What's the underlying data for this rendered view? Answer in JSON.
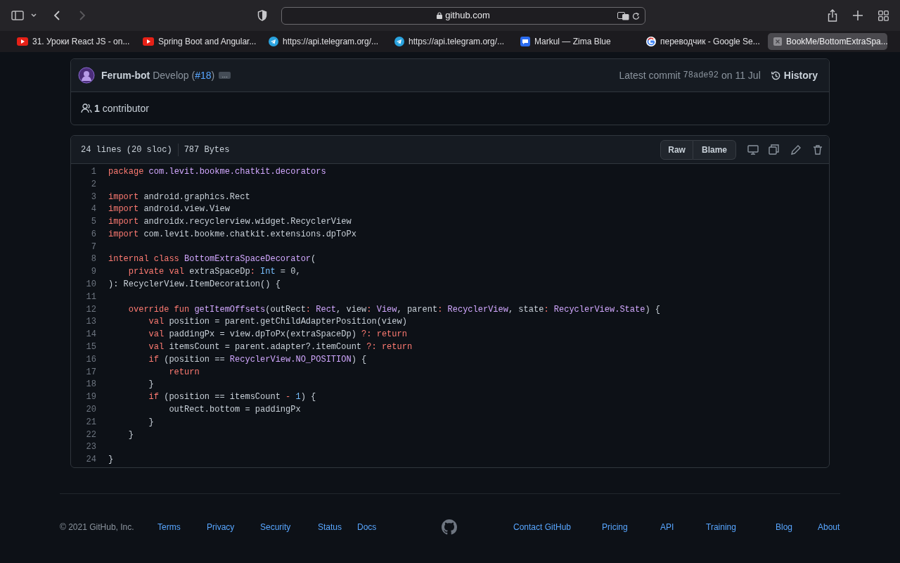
{
  "browser": {
    "address": "github.com",
    "tabs": [
      {
        "label": "31. Уроки React JS - on...",
        "kind": "video",
        "selected": false
      },
      {
        "label": "Spring Boot and Angular...",
        "kind": "video",
        "selected": false
      },
      {
        "label": "https://api.telegram.org/...",
        "kind": "telegram",
        "selected": false
      },
      {
        "label": "https://api.telegram.org/...",
        "kind": "telegram",
        "selected": false
      },
      {
        "label": "Markul — Zima Blue",
        "kind": "chat",
        "selected": false
      },
      {
        "label": "переводчик - Google Se...",
        "kind": "google",
        "selected": false
      },
      {
        "label": "BookMe/BottomExtraSpa...",
        "kind": "close",
        "selected": true
      }
    ]
  },
  "commit": {
    "author": "Ferum-bot",
    "message": "Develop (",
    "pr": "#18",
    "message_end": ")",
    "ellipsis": "…",
    "latest_label": "Latest commit",
    "sha": "78ade92",
    "date": "on 11 Jul",
    "history": "History",
    "contributors": "1",
    "contributors_label": "contributor"
  },
  "file": {
    "lines_info": "24 lines (20 sloc)",
    "size": "787 Bytes",
    "buttons": [
      "Raw",
      "Blame"
    ],
    "lines": [
      {
        "number": "1",
        "tokens": [
          {
            "kind": "keyword",
            "text": "package"
          },
          {
            "kind": "entity",
            "text": " com.levit.bookme.chatkit.decorators"
          }
        ]
      },
      {
        "number": "2"
      },
      {
        "number": "3",
        "tokens": [
          {
            "kind": "keyword",
            "text": "import"
          },
          {
            "kind": "plain",
            "text": " android.graphics.Rect"
          }
        ]
      },
      {
        "number": "4",
        "tokens": [
          {
            "kind": "keyword",
            "text": "import"
          },
          {
            "kind": "plain",
            "text": " android.view.View"
          }
        ]
      },
      {
        "number": "5",
        "tokens": [
          {
            "kind": "keyword",
            "text": "import"
          },
          {
            "kind": "plain",
            "text": " androidx.recyclerview.widget.RecyclerView"
          }
        ]
      },
      {
        "number": "6",
        "tokens": [
          {
            "kind": "keyword",
            "text": "import"
          },
          {
            "kind": "plain",
            "text": " com.levit.bookme.chatkit.extensions.dpToPx"
          }
        ]
      },
      {
        "number": "7"
      },
      {
        "number": "8",
        "tokens": [
          {
            "kind": "keyword",
            "text": "internal class"
          },
          {
            "kind": "entity",
            "text": " BottomExtraSpaceDecorator"
          },
          {
            "kind": "plain",
            "text": "("
          }
        ]
      },
      {
        "number": "9",
        "tokens": [
          {
            "kind": "keyword",
            "text": "    private val"
          },
          {
            "kind": "plain",
            "text": " extraSpaceDp"
          },
          {
            "kind": "keyword",
            "text": ":"
          },
          {
            "kind": "constant",
            "text": " Int"
          },
          {
            "kind": "plain",
            "text": " = 0,"
          }
        ]
      },
      {
        "number": "10",
        "tokens": [
          {
            "kind": "plain",
            "text": "): RecyclerView.ItemDecoration() {"
          }
        ]
      },
      {
        "number": "11"
      },
      {
        "number": "12",
        "tokens": [
          {
            "kind": "keyword",
            "text": "    override fun"
          },
          {
            "kind": "entity",
            "text": " getItemOffsets"
          },
          {
            "kind": "plain",
            "text": "(outRect"
          },
          {
            "kind": "keyword",
            "text": ":"
          },
          {
            "kind": "entity",
            "text": " Rect"
          },
          {
            "kind": "plain",
            "text": ", view"
          },
          {
            "kind": "keyword",
            "text": ":"
          },
          {
            "kind": "entity",
            "text": " View"
          },
          {
            "kind": "plain",
            "text": ", parent"
          },
          {
            "kind": "keyword",
            "text": ":"
          },
          {
            "kind": "entity",
            "text": " RecyclerView"
          },
          {
            "kind": "plain",
            "text": ", state"
          },
          {
            "kind": "keyword",
            "text": ":"
          },
          {
            "kind": "entity",
            "text": " RecyclerView.State"
          },
          {
            "kind": "plain",
            "text": ") {"
          }
        ]
      },
      {
        "number": "13",
        "tokens": [
          {
            "kind": "keyword",
            "text": "        val"
          },
          {
            "kind": "plain",
            "text": " position = parent.getChildAdapterPosition(view)"
          }
        ]
      },
      {
        "number": "14",
        "tokens": [
          {
            "kind": "keyword",
            "text": "        val"
          },
          {
            "kind": "plain",
            "text": " paddingPx = view.dpToPx(extraSpaceDp)"
          },
          {
            "kind": "keyword",
            "text": " ?: return"
          }
        ]
      },
      {
        "number": "15",
        "tokens": [
          {
            "kind": "keyword",
            "text": "        val"
          },
          {
            "kind": "plain",
            "text": " itemsCount = parent.adapter?.itemCount"
          },
          {
            "kind": "keyword",
            "text": " ?: return"
          }
        ]
      },
      {
        "number": "16",
        "tokens": [
          {
            "kind": "keyword",
            "text": "        if"
          },
          {
            "kind": "plain",
            "text": " (position =="
          },
          {
            "kind": "entity",
            "text": " RecyclerView.NO_POSITION"
          },
          {
            "kind": "plain",
            "text": ") {"
          }
        ]
      },
      {
        "number": "17",
        "tokens": [
          {
            "kind": "keyword",
            "text": "            return"
          }
        ]
      },
      {
        "number": "18",
        "tokens": [
          {
            "kind": "plain",
            "text": "        }"
          }
        ]
      },
      {
        "number": "19",
        "tokens": [
          {
            "kind": "keyword",
            "text": "        if"
          },
          {
            "kind": "plain",
            "text": " (position == itemsCount"
          },
          {
            "kind": "keyword",
            "text": " -"
          },
          {
            "kind": "constant",
            "text": " 1"
          },
          {
            "kind": "plain",
            "text": ") {"
          }
        ]
      },
      {
        "number": "20",
        "tokens": [
          {
            "kind": "plain",
            "text": "            outRect.bottom = paddingPx"
          }
        ]
      },
      {
        "number": "21",
        "tokens": [
          {
            "kind": "plain",
            "text": "        }"
          }
        ]
      },
      {
        "number": "22",
        "tokens": [
          {
            "kind": "plain",
            "text": "    }"
          }
        ]
      },
      {
        "number": "23"
      },
      {
        "number": "24",
        "tokens": [
          {
            "kind": "plain",
            "text": "}"
          }
        ]
      }
    ]
  },
  "footer": {
    "copyright": "© 2021 GitHub, Inc.",
    "left_links": [
      "Terms",
      "Privacy",
      "Security",
      "Status",
      "Docs"
    ],
    "right_links": [
      "Contact GitHub",
      "Pricing",
      "API",
      "Training",
      "Blog",
      "About"
    ]
  }
}
